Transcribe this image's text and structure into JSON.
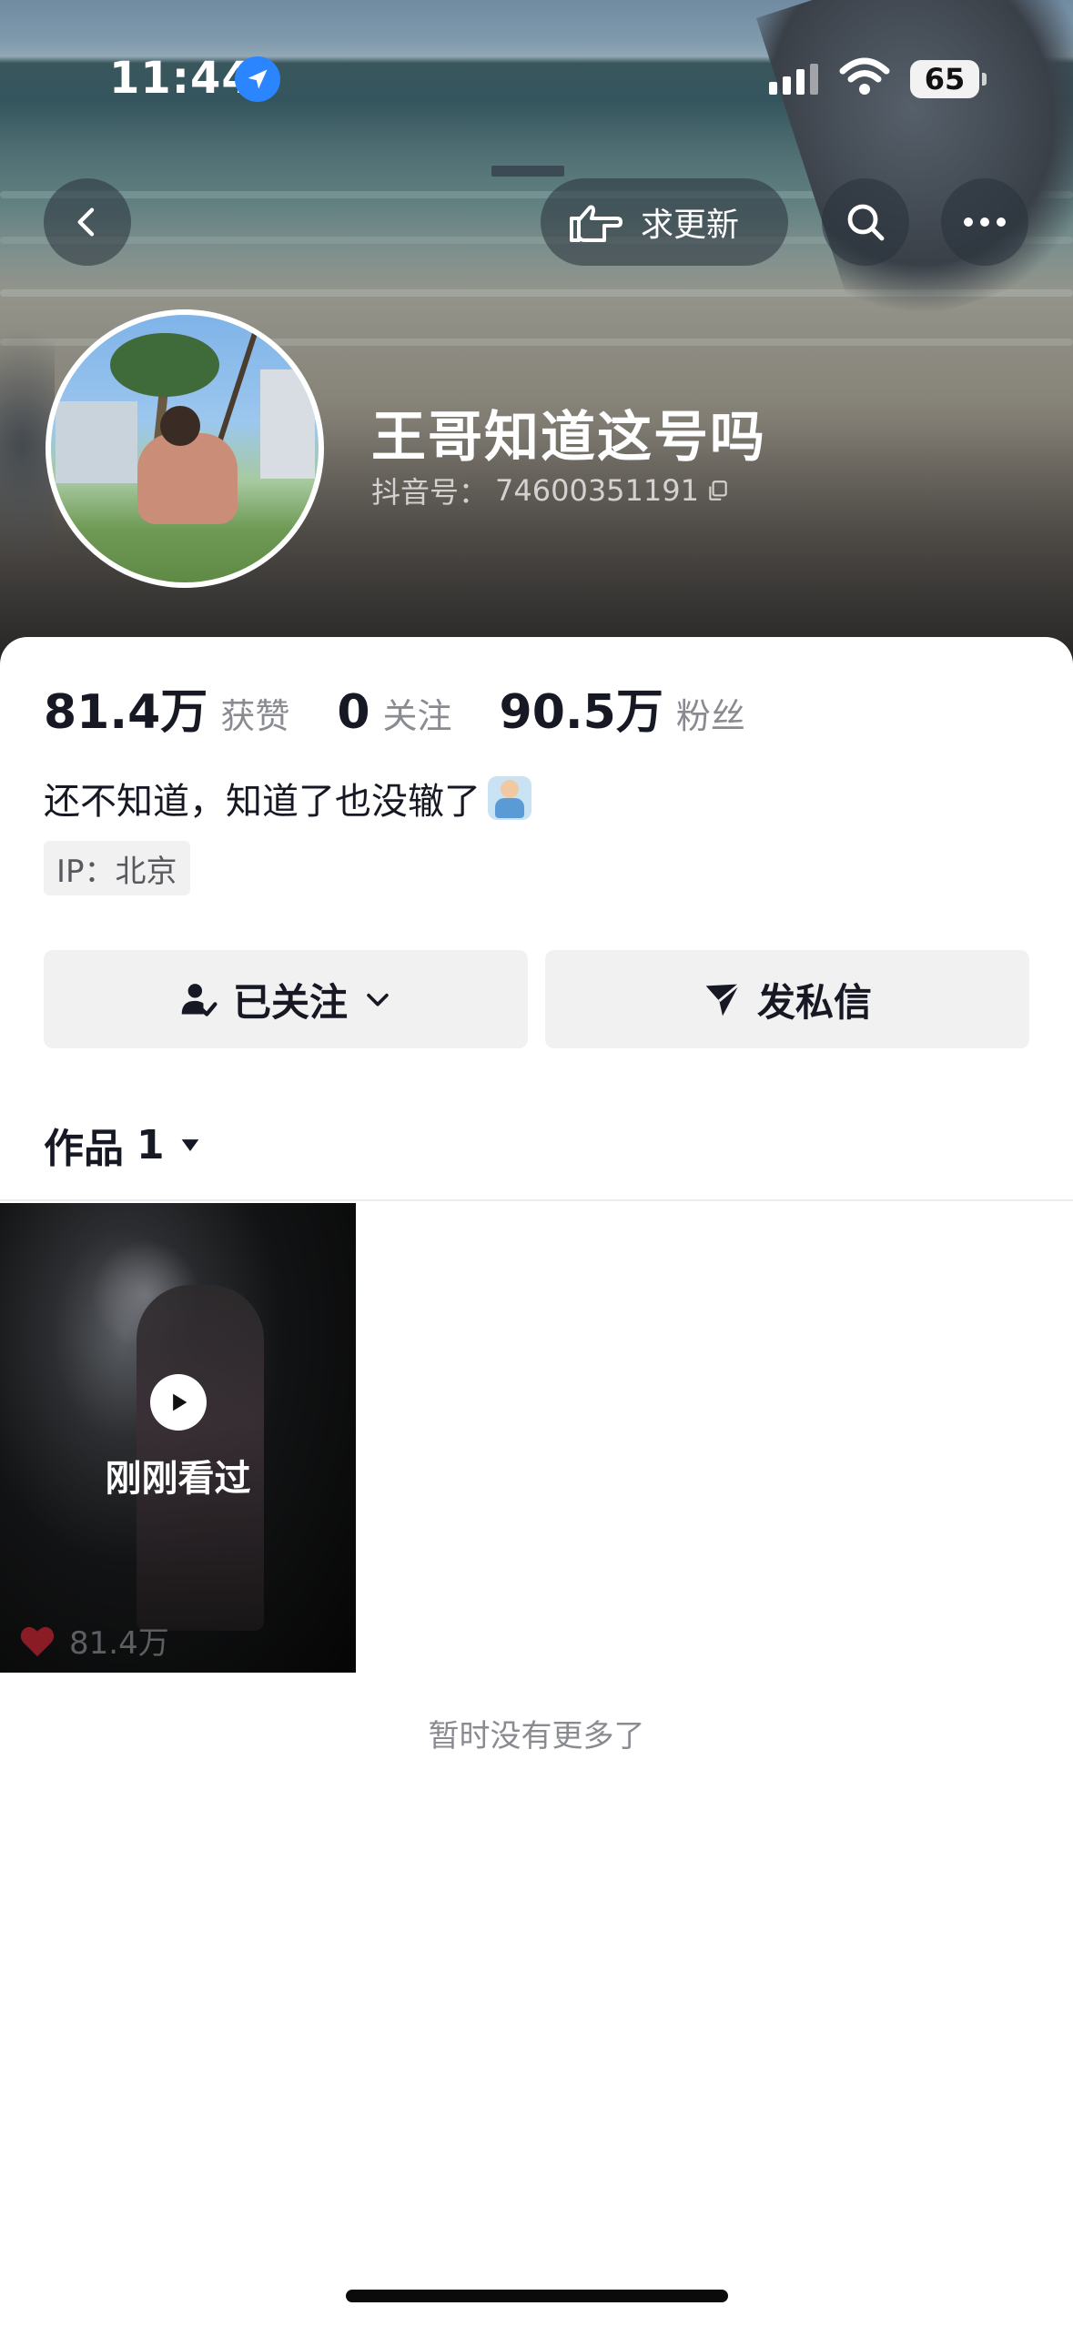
{
  "status_bar": {
    "time": "11:44",
    "battery": "65",
    "location_icon": "location-arrow-icon",
    "signal_icon": "cellular-signal-icon",
    "wifi_icon": "wifi-icon"
  },
  "nav": {
    "back_icon": "chevron-left-icon",
    "update_label": "求更新",
    "update_icon": "pointing-hand-icon",
    "search_icon": "search-icon",
    "more_icon": "more-dots-icon"
  },
  "profile": {
    "name": "王哥知道这号吗",
    "douyin_id_label": "抖音号：",
    "douyin_id": "74600351191",
    "copy_icon": "copy-icon",
    "stats": [
      {
        "value": "81.4万",
        "label": "获赞"
      },
      {
        "value": "0",
        "label": "关注"
      },
      {
        "value": "90.5万",
        "label": "粉丝"
      }
    ],
    "bio": "还不知道，知道了也没辙了",
    "bio_emoji": "shrug-emoji",
    "ip": "IP：北京"
  },
  "actions": {
    "follow_label": "已关注",
    "follow_icon": "user-check-icon",
    "follow_dropdown_icon": "chevron-down-icon",
    "message_label": "发私信",
    "message_icon": "paper-plane-icon"
  },
  "tabs": {
    "works_label": "作品",
    "works_count": "1",
    "dropdown_icon": "caret-down-icon"
  },
  "videos": [
    {
      "overlay_text": "刚刚看过",
      "likes": "81.4万",
      "like_icon": "heart-icon",
      "play_icon": "play-icon"
    }
  ],
  "footer": {
    "no_more": "暂时没有更多了"
  },
  "colors": {
    "primary_text": "#161823",
    "secondary_text": "#8a8b91",
    "button_bg": "#f1f1f2",
    "like_red": "#8a1c25",
    "location_blue": "#2a85ff"
  }
}
